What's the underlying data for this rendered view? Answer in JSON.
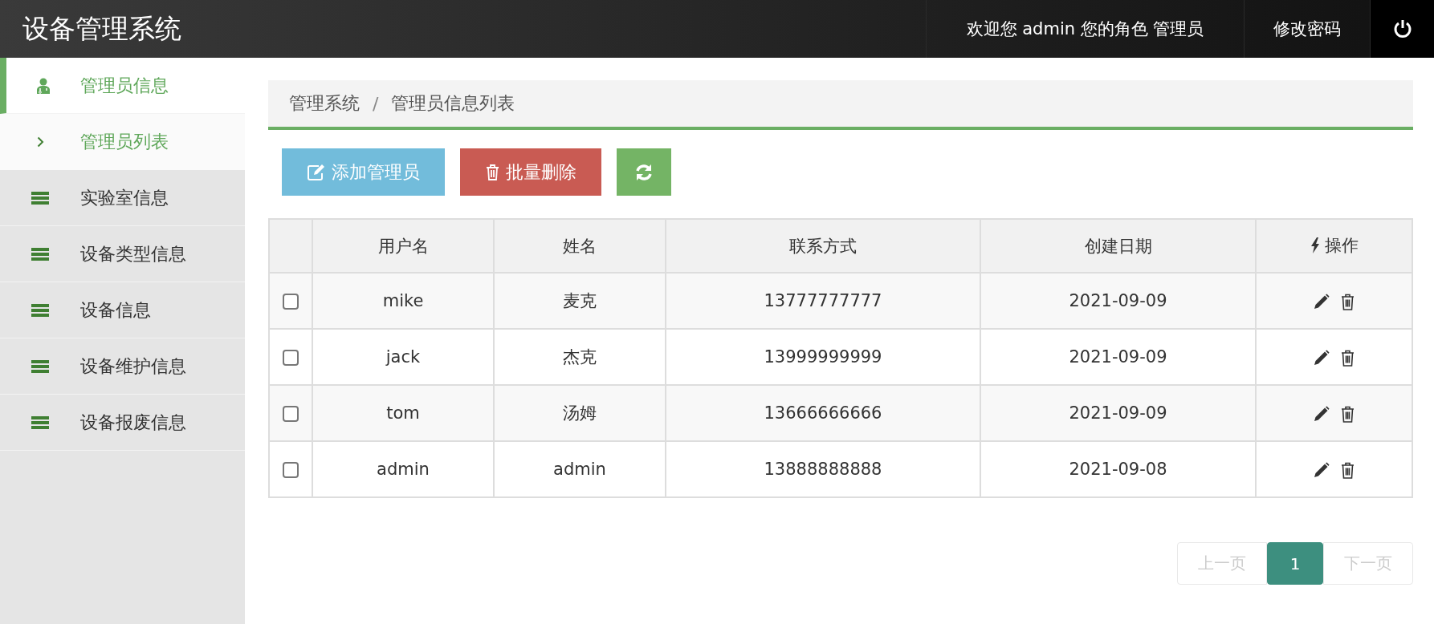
{
  "header": {
    "title": "设备管理系统",
    "welcome": "欢迎您 admin 您的角色 管理员",
    "change_password": "修改密码"
  },
  "sidebar": {
    "items": [
      {
        "kind": "person",
        "label": "管理员信息",
        "expanded": true,
        "children": [
          {
            "label": "管理员列表",
            "selected": true
          }
        ]
      },
      {
        "kind": "list",
        "label": "实验室信息",
        "expanded": false
      },
      {
        "kind": "list",
        "label": "设备类型信息",
        "expanded": false
      },
      {
        "kind": "list",
        "label": "设备信息",
        "expanded": false
      },
      {
        "kind": "list",
        "label": "设备维护信息",
        "expanded": false
      },
      {
        "kind": "list",
        "label": "设备报废信息",
        "expanded": false
      }
    ]
  },
  "breadcrumb": {
    "separator": "/",
    "items": [
      "管理系统",
      "管理员信息列表"
    ]
  },
  "toolbar": [
    {
      "kind": "add",
      "label": "添加管理员"
    },
    {
      "kind": "delete",
      "label": "批量删除"
    },
    {
      "kind": "refresh"
    }
  ],
  "table": {
    "columns": [
      "用户名",
      "姓名",
      "联系方式",
      "创建日期",
      "操作"
    ],
    "rows": [
      {
        "checked": false,
        "cells": [
          "mike",
          "麦克",
          "13777777777",
          "2021-09-09"
        ]
      },
      {
        "checked": false,
        "cells": [
          "jack",
          "杰克",
          "13999999999",
          "2021-09-09"
        ]
      },
      {
        "checked": false,
        "cells": [
          "tom",
          "汤姆",
          "13666666666",
          "2021-09-09"
        ]
      },
      {
        "checked": false,
        "cells": [
          "admin",
          "admin",
          "13888888888",
          "2021-09-08"
        ]
      }
    ]
  },
  "pagination": [
    {
      "label": "上一页",
      "selected": false,
      "disabled": true
    },
    {
      "label": "1",
      "selected": true,
      "disabled": false
    },
    {
      "label": "下一页",
      "selected": false,
      "disabled": true
    }
  ]
}
